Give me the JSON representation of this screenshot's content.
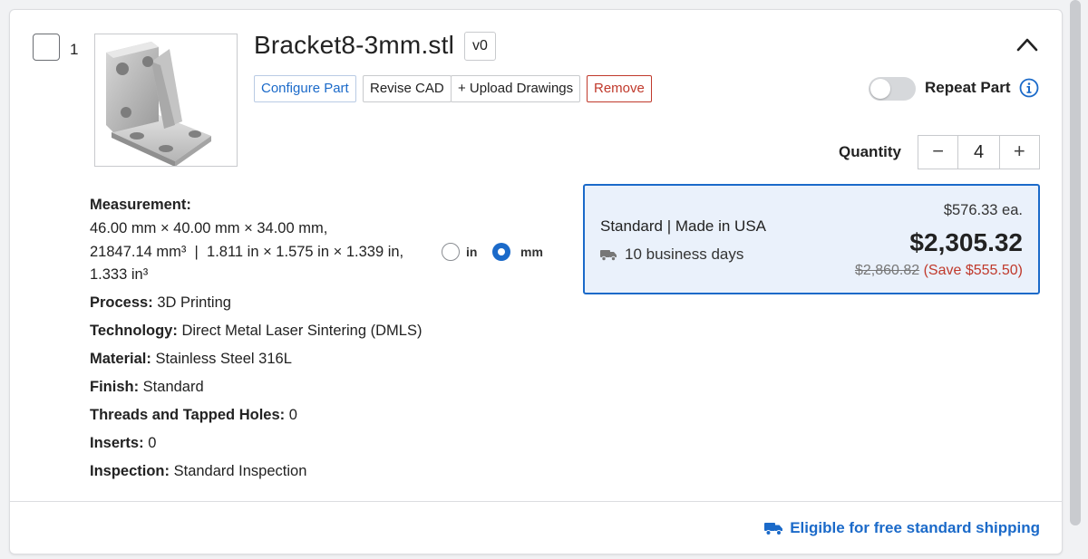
{
  "part": {
    "index": "1",
    "filename": "Bracket8-3mm.stl",
    "version": "v0"
  },
  "actions": {
    "configure": "Configure Part",
    "revise": "Revise CAD",
    "upload": "+ Upload Drawings",
    "remove": "Remove"
  },
  "repeat": {
    "label": "Repeat Part",
    "enabled": false
  },
  "quantity": {
    "label": "Quantity",
    "value": "4",
    "decrement": "−",
    "increment": "+"
  },
  "measurement": {
    "label": "Measurement:",
    "line1": "46.00 mm × 40.00 mm × 34.00 mm,",
    "line2": "21847.14 mm³  |  1.811 in × 1.575 in × 1.339 in,",
    "line3": "1.333 in³",
    "unit_in": "in",
    "unit_mm": "mm",
    "selected_unit": "mm"
  },
  "specs": [
    {
      "label": "Process:",
      "value": "3D Printing"
    },
    {
      "label": "Technology:",
      "value": "Direct Metal Laser Sintering (DMLS)"
    },
    {
      "label": "Material:",
      "value": "Stainless Steel 316L"
    },
    {
      "label": "Finish:",
      "value": "Standard"
    },
    {
      "label": "Threads and Tapped Holes:",
      "value": "0"
    },
    {
      "label": "Inserts:",
      "value": "0"
    },
    {
      "label": "Inspection:",
      "value": "Standard Inspection"
    }
  ],
  "pricing": {
    "option": "Standard | Made in USA",
    "lead_time": "10 business days",
    "each": "$576.33 ea.",
    "total": "$2,305.32",
    "original": "$2,860.82",
    "savings": "(Save $555.50)"
  },
  "shipping": {
    "text": "Eligible for free standard shipping"
  },
  "colors": {
    "accent": "#1b6ac9",
    "danger": "#c0392b",
    "price_box_bg": "#eaf1fb"
  },
  "icons": {
    "collapse": "chevron-up-icon",
    "info": "info-icon",
    "lead_time": "truck-icon",
    "shipping": "truck-icon"
  }
}
